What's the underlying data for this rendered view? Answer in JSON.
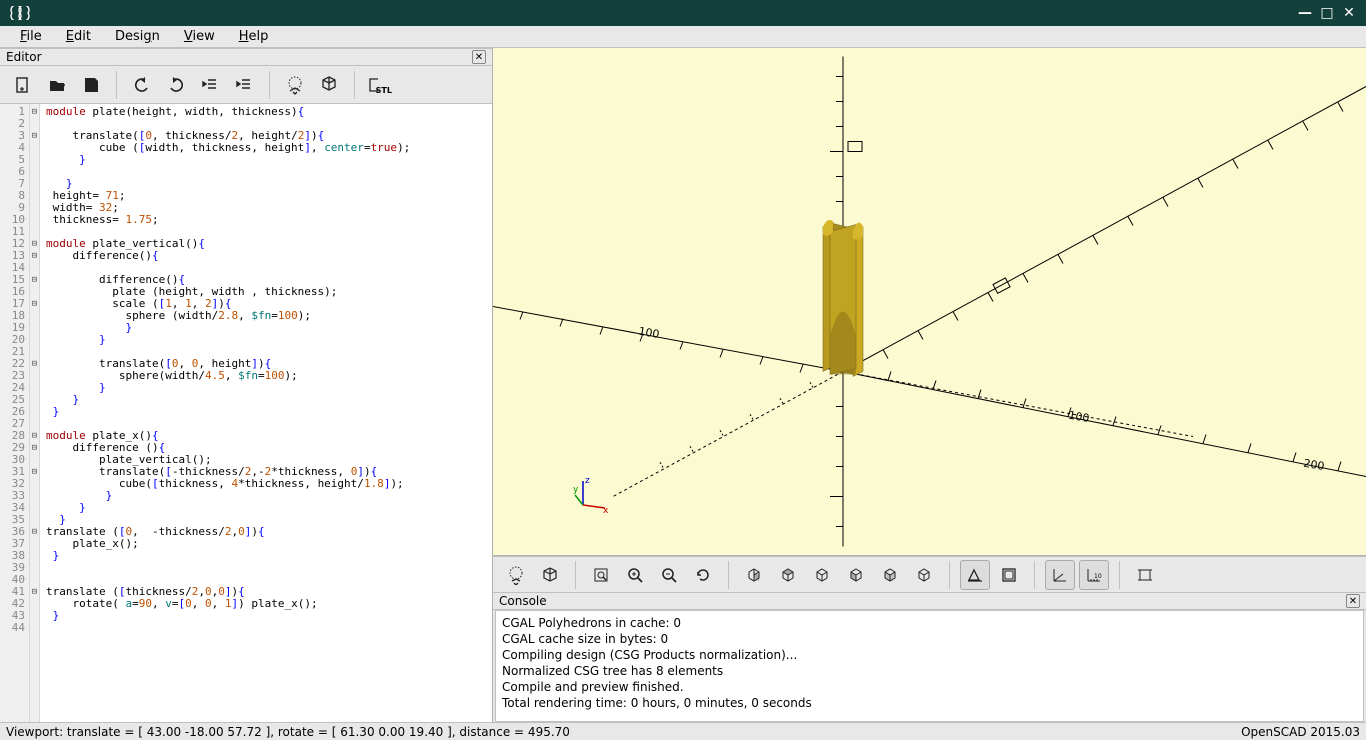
{
  "window": {
    "title": ""
  },
  "menus": {
    "file": "File",
    "edit": "Edit",
    "design": "Design",
    "view": "View",
    "help": "Help"
  },
  "editor": {
    "title": "Editor",
    "line_count": 44,
    "fold_markers": {
      "1": "-",
      "3": "-",
      "5": " ",
      "7": " ",
      "12": "-",
      "13": "-",
      "15": "-",
      "17": "-",
      "19": " ",
      "20": " ",
      "22": "-",
      "24": " ",
      "25": " ",
      "26": " ",
      "28": "-",
      "29": "-",
      "31": "-",
      "33": " ",
      "34": " ",
      "35": " ",
      "36": "-",
      "38": " ",
      "41": "-",
      "43": " "
    },
    "code_lines": [
      {
        "n": 1,
        "html": "<span class='tok-kw'>module</span> plate(height, width, thickness)<span class='tok-op'>{</span>"
      },
      {
        "n": 2,
        "html": ""
      },
      {
        "n": 3,
        "html": "    <span class='tok-fn'>translate</span>(<span class='tok-op'>[</span><span class='tok-num'>0</span>, thickness/<span class='tok-num'>2</span>, height/<span class='tok-num'>2</span><span class='tok-op'>]</span>)<span class='tok-op'>{</span>"
      },
      {
        "n": 4,
        "html": "        <span class='tok-fn'>cube</span> (<span class='tok-op'>[</span>width, thickness, height<span class='tok-op'>]</span>, <span class='tok-param'>center</span>=<span class='tok-true'>true</span>);"
      },
      {
        "n": 5,
        "html": "     <span class='tok-op'>}</span>"
      },
      {
        "n": 6,
        "html": ""
      },
      {
        "n": 7,
        "html": "   <span class='tok-op'>}</span>"
      },
      {
        "n": 8,
        "html": " height= <span class='tok-num'>71</span>;"
      },
      {
        "n": 9,
        "html": " width= <span class='tok-num'>32</span>;"
      },
      {
        "n": 10,
        "html": " thickness= <span class='tok-num'>1.75</span>;"
      },
      {
        "n": 11,
        "html": ""
      },
      {
        "n": 12,
        "html": "<span class='tok-kw'>module</span> plate_vertical()<span class='tok-op'>{</span>"
      },
      {
        "n": 13,
        "html": "    <span class='tok-fn'>difference</span>()<span class='tok-op'>{</span>"
      },
      {
        "n": 14,
        "html": ""
      },
      {
        "n": 15,
        "html": "        <span class='tok-fn'>difference</span>()<span class='tok-op'>{</span>"
      },
      {
        "n": 16,
        "html": "          plate (height, width , thickness);"
      },
      {
        "n": 17,
        "html": "          <span class='tok-fn'>scale</span> (<span class='tok-op'>[</span><span class='tok-num'>1</span>, <span class='tok-num'>1</span>, <span class='tok-num'>2</span><span class='tok-op'>]</span>)<span class='tok-op'>{</span>"
      },
      {
        "n": 18,
        "html": "            <span class='tok-fn'>sphere</span> (width/<span class='tok-num'>2.8</span>, <span class='tok-param'>$fn</span>=<span class='tok-num'>100</span>);"
      },
      {
        "n": 19,
        "html": "            <span class='tok-op'>}</span>"
      },
      {
        "n": 20,
        "html": "        <span class='tok-op'>}</span>"
      },
      {
        "n": 21,
        "html": ""
      },
      {
        "n": 22,
        "html": "        <span class='tok-fn'>translate</span>(<span class='tok-op'>[</span><span class='tok-num'>0</span>, <span class='tok-num'>0</span>, height<span class='tok-op'>]</span>)<span class='tok-op'>{</span>"
      },
      {
        "n": 23,
        "html": "           <span class='tok-fn'>sphere</span>(width/<span class='tok-num'>4.5</span>, <span class='tok-param'>$fn</span>=<span class='tok-num'>100</span>);"
      },
      {
        "n": 24,
        "html": "        <span class='tok-op'>}</span>"
      },
      {
        "n": 25,
        "html": "    <span class='tok-op'>}</span>"
      },
      {
        "n": 26,
        "html": " <span class='tok-op'>}</span>"
      },
      {
        "n": 27,
        "html": ""
      },
      {
        "n": 28,
        "html": "<span class='tok-kw'>module</span> plate_x()<span class='tok-op'>{</span>"
      },
      {
        "n": 29,
        "html": "    <span class='tok-fn'>difference</span> ()<span class='tok-op'>{</span>"
      },
      {
        "n": 30,
        "html": "        plate_vertical();"
      },
      {
        "n": 31,
        "html": "        <span class='tok-fn'>translate</span>(<span class='tok-op'>[</span>-thickness/<span class='tok-num'>2</span>,-<span class='tok-num'>2</span>*thickness, <span class='tok-num'>0</span><span class='tok-op'>]</span>)<span class='tok-op'>{</span>"
      },
      {
        "n": 32,
        "html": "           <span class='tok-fn'>cube</span>(<span class='tok-op'>[</span>thickness, <span class='tok-num'>4</span>*thickness, height/<span class='tok-num'>1.8</span><span class='tok-op'>]</span>);"
      },
      {
        "n": 33,
        "html": "         <span class='tok-op'>}</span>"
      },
      {
        "n": 34,
        "html": "     <span class='tok-op'>}</span>"
      },
      {
        "n": 35,
        "html": "  <span class='tok-op'>}</span>"
      },
      {
        "n": 36,
        "html": "<span class='tok-fn'>translate</span> (<span class='tok-op'>[</span><span class='tok-num'>0</span>,  -thickness/<span class='tok-num'>2</span>,<span class='tok-num'>0</span><span class='tok-op'>]</span>)<span class='tok-op'>{</span>"
      },
      {
        "n": 37,
        "html": "    plate_x();"
      },
      {
        "n": 38,
        "html": " <span class='tok-op'>}</span>"
      },
      {
        "n": 39,
        "html": ""
      },
      {
        "n": 40,
        "html": ""
      },
      {
        "n": 41,
        "html": "<span class='tok-fn'>translate</span> (<span class='tok-op'>[</span>thickness/<span class='tok-num'>2</span>,<span class='tok-num'>0</span>,<span class='tok-num'>0</span><span class='tok-op'>]</span>)<span class='tok-op'>{</span>"
      },
      {
        "n": 42,
        "html": "    <span class='tok-fn'>rotate</span>( <span class='tok-param'>a</span>=<span class='tok-num'>90</span>, <span class='tok-param'>v</span>=<span class='tok-op'>[</span><span class='tok-num'>0</span>, <span class='tok-num'>0</span>, <span class='tok-num'>1</span><span class='tok-op'>]</span>) plate_x();"
      },
      {
        "n": 43,
        "html": " <span class='tok-op'>}</span>"
      },
      {
        "n": 44,
        "html": ""
      }
    ]
  },
  "console": {
    "title": "Console",
    "lines": [
      "CGAL Polyhedrons in cache: 0",
      "CGAL cache size in bytes: 0",
      "Compiling design (CSG Products normalization)...",
      "Normalized CSG tree has 8 elements",
      "Compile and preview finished.",
      "Total rendering time: 0 hours, 0 minutes, 0 seconds"
    ]
  },
  "status": {
    "left": "Viewport: translate = [ 43.00 -18.00 57.72 ], rotate = [ 61.30 0.00 19.40 ], distance = 495.70",
    "right": "OpenSCAD 2015.03"
  },
  "axes": {
    "z": "z",
    "y": "y",
    "x": "x"
  },
  "viewport_ticks": {
    "left": "100",
    "right1": "100",
    "right2": "200"
  },
  "stl": "STL"
}
